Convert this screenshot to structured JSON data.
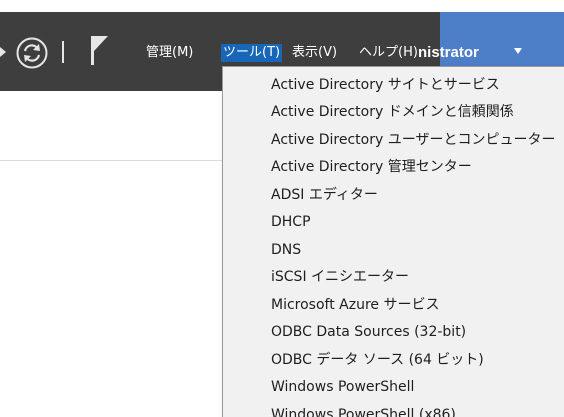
{
  "menubar": {
    "items": [
      {
        "label": "管理(M)",
        "active": false
      },
      {
        "label": "ツール(T)",
        "active": true
      },
      {
        "label": "表示(V)",
        "active": false
      },
      {
        "label": "ヘルプ(H)",
        "active": false
      }
    ]
  },
  "user": {
    "label": "nistrator"
  },
  "tools_menu": {
    "items": [
      "Active Directory サイトとサービス",
      "Active Directory ドメインと信頼関係",
      "Active Directory ユーザーとコンピューター",
      "Active Directory 管理センター",
      "ADSI エディター",
      "DHCP",
      "DNS",
      "iSCSI イニシエーター",
      "Microsoft Azure サービス",
      "ODBC Data Sources (32-bit)",
      "ODBC データ ソース (64 ビット)",
      "Windows PowerShell",
      "Windows PowerShell (x86)"
    ]
  },
  "colors": {
    "toolbar_bg": "#3e3e3e",
    "user_bar_bg": "#4d7fc9",
    "active_menu_bg": "#1766b8",
    "menu_bg": "#f1f1f1"
  },
  "icons": [
    "refresh-icon",
    "flag-icon",
    "chevron-down-icon"
  ]
}
